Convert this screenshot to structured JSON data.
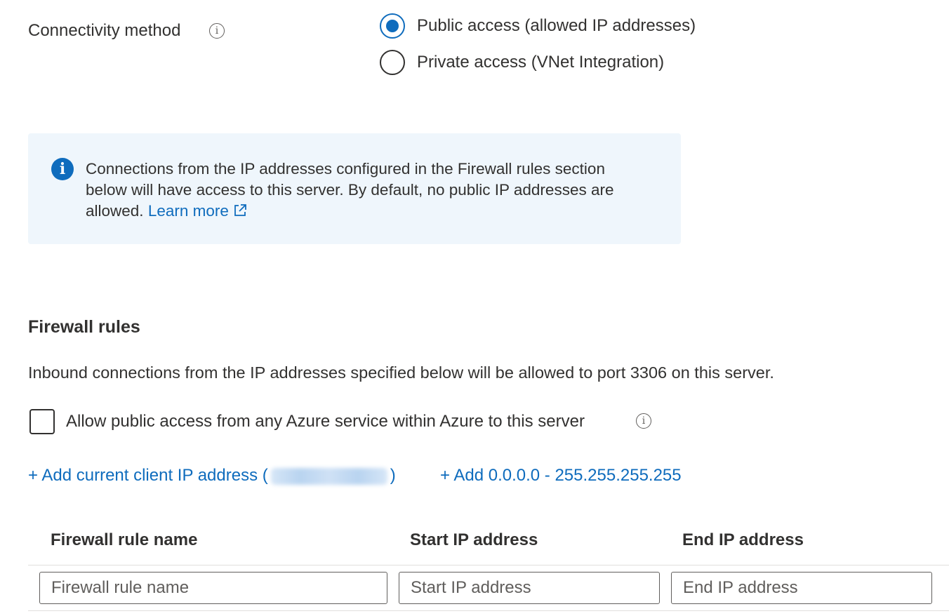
{
  "connectivity": {
    "label": "Connectivity method",
    "options": [
      {
        "label": "Public access (allowed IP addresses)",
        "selected": true
      },
      {
        "label": "Private access (VNet Integration)",
        "selected": false
      }
    ]
  },
  "banner": {
    "text": "Connections from the IP addresses configured in the Firewall rules section below will have access to this server. By default, no public IP addresses are allowed.",
    "link": "Learn more"
  },
  "firewall": {
    "title": "Firewall rules",
    "description": "Inbound connections from the IP addresses specified below will be allowed to port 3306 on this server.",
    "allow_azure_label": "Allow public access from any Azure service within Azure to this server",
    "allow_azure_checked": false,
    "add_client_ip_prefix": "+ Add current client IP address (",
    "add_client_ip_suffix": ")",
    "add_all_range": "+ Add 0.0.0.0 - 255.255.255.255",
    "table": {
      "headers": [
        "Firewall rule name",
        "Start IP address",
        "End IP address"
      ],
      "placeholders": [
        "Firewall rule name",
        "Start IP address",
        "End IP address"
      ]
    }
  },
  "colors": {
    "accent": "#0f6cbd",
    "banner_bg": "#eff6fc"
  }
}
